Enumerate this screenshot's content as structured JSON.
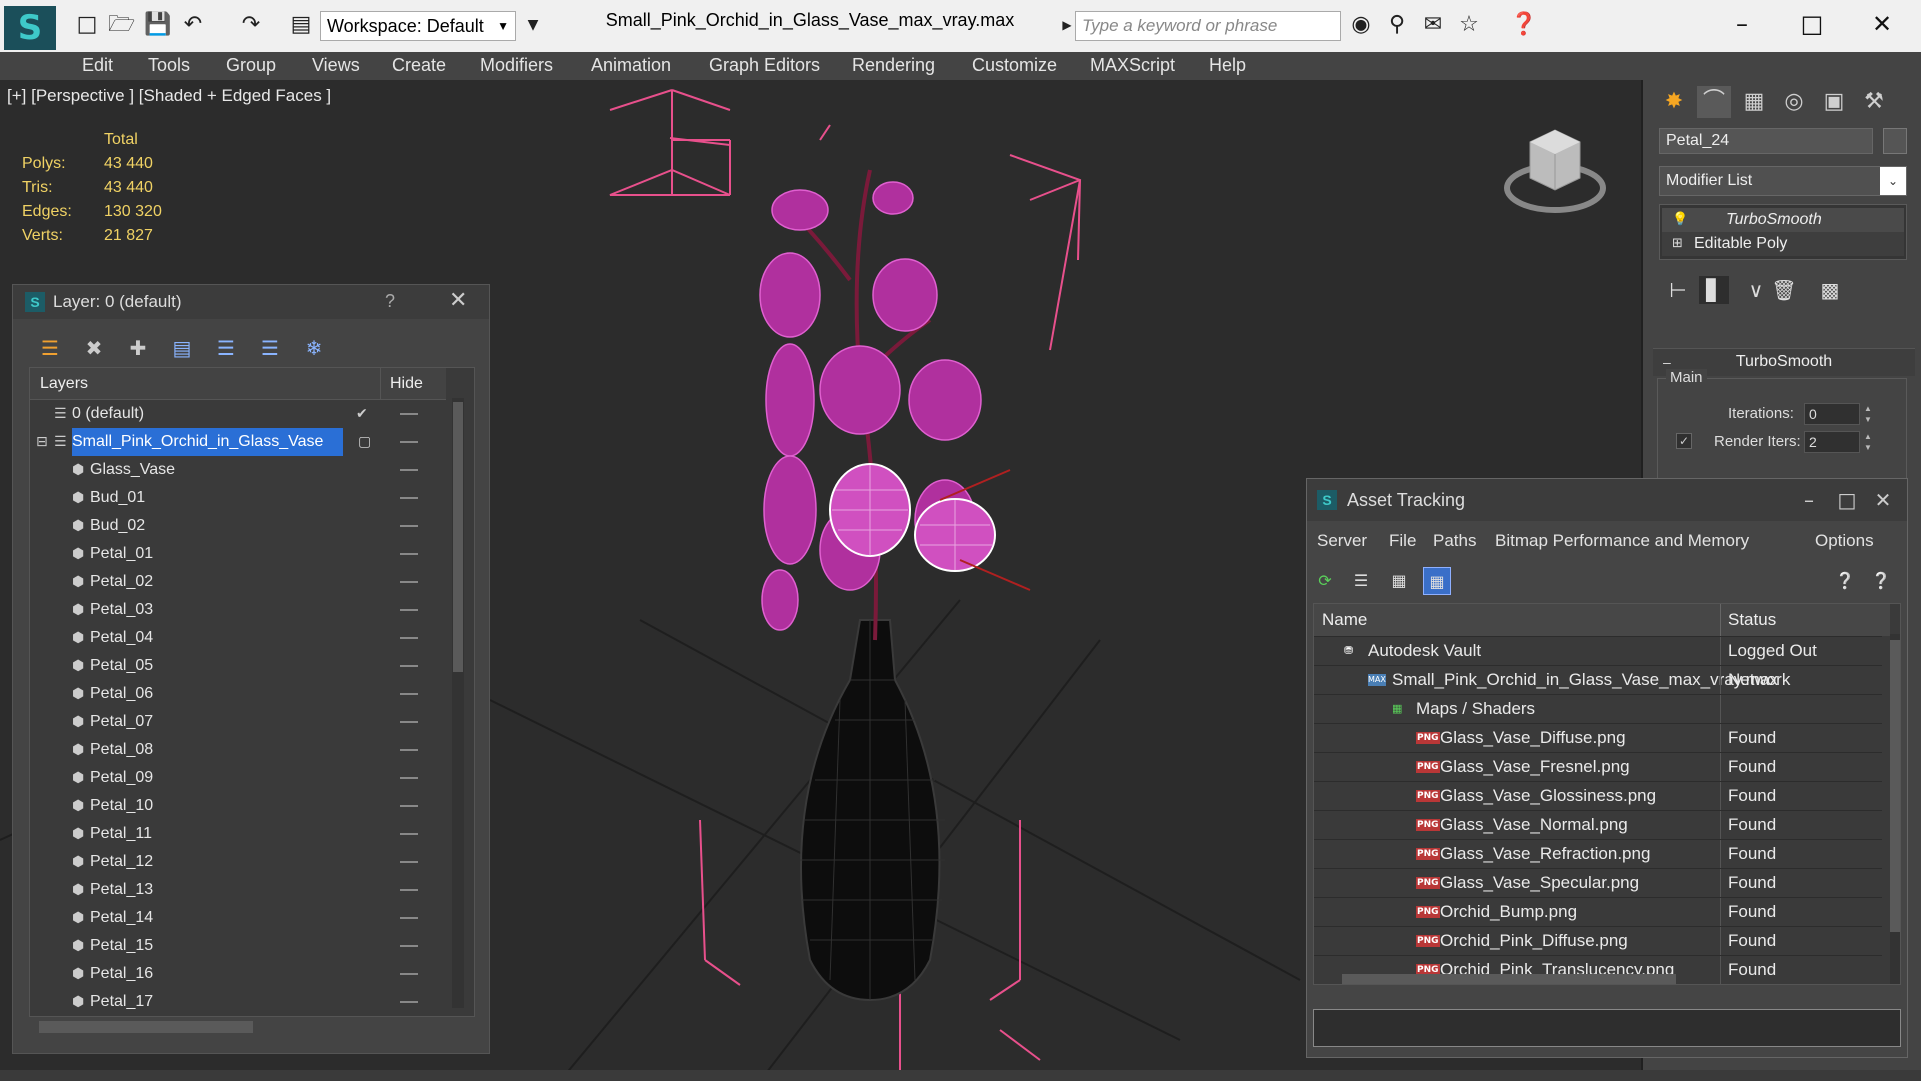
{
  "app": {
    "document_title": "Small_Pink_Orchid_in_Glass_Vase_max_vray.max",
    "workspace": "Workspace: Default",
    "search_placeholder": "Type a keyword or phrase"
  },
  "menu": [
    "Edit",
    "Tools",
    "Group",
    "Views",
    "Create",
    "Modifiers",
    "Animation",
    "Graph Editors",
    "Rendering",
    "Customize",
    "MAXScript",
    "Help"
  ],
  "viewport": {
    "label": "[+] [Perspective ] [Shaded + Edged Faces ]",
    "stats_header": "Total",
    "stats": [
      {
        "k": "Polys:",
        "v": "43 440"
      },
      {
        "k": "Tris:",
        "v": "43 440"
      },
      {
        "k": "Edges:",
        "v": "130 320"
      },
      {
        "k": "Verts:",
        "v": "21 827"
      }
    ]
  },
  "command_panel": {
    "object_name": "Petal_24",
    "modifier_list": "Modifier List",
    "stack": [
      "TurboSmooth",
      "Editable Poly"
    ],
    "rollout_title": "TurboSmooth",
    "group_main": "Main",
    "iterations_label": "Iterations:",
    "iterations_value": "0",
    "render_iters_label": "Render Iters:",
    "render_iters_value": "2",
    "render_iters_checked": true
  },
  "layer_window": {
    "title": "Layer: 0 (default)",
    "help": "?",
    "col_layers": "Layers",
    "col_hide": "Hide",
    "rows": [
      {
        "name": "0 (default)",
        "level": 0,
        "type": "layer",
        "current": true
      },
      {
        "name": "Small_Pink_Orchid_in_Glass_Vase",
        "level": 0,
        "type": "layer",
        "selected": true
      },
      {
        "name": "Glass_Vase",
        "level": 1,
        "type": "object"
      },
      {
        "name": "Bud_01",
        "level": 1,
        "type": "object"
      },
      {
        "name": "Bud_02",
        "level": 1,
        "type": "object"
      },
      {
        "name": "Petal_01",
        "level": 1,
        "type": "object"
      },
      {
        "name": "Petal_02",
        "level": 1,
        "type": "object"
      },
      {
        "name": "Petal_03",
        "level": 1,
        "type": "object"
      },
      {
        "name": "Petal_04",
        "level": 1,
        "type": "object"
      },
      {
        "name": "Petal_05",
        "level": 1,
        "type": "object"
      },
      {
        "name": "Petal_06",
        "level": 1,
        "type": "object"
      },
      {
        "name": "Petal_07",
        "level": 1,
        "type": "object"
      },
      {
        "name": "Petal_08",
        "level": 1,
        "type": "object"
      },
      {
        "name": "Petal_09",
        "level": 1,
        "type": "object"
      },
      {
        "name": "Petal_10",
        "level": 1,
        "type": "object"
      },
      {
        "name": "Petal_11",
        "level": 1,
        "type": "object"
      },
      {
        "name": "Petal_12",
        "level": 1,
        "type": "object"
      },
      {
        "name": "Petal_13",
        "level": 1,
        "type": "object"
      },
      {
        "name": "Petal_14",
        "level": 1,
        "type": "object"
      },
      {
        "name": "Petal_15",
        "level": 1,
        "type": "object"
      },
      {
        "name": "Petal_16",
        "level": 1,
        "type": "object"
      },
      {
        "name": "Petal_17",
        "level": 1,
        "type": "object"
      }
    ]
  },
  "asset_window": {
    "title": "Asset Tracking",
    "menu": [
      "Server",
      "File",
      "Paths",
      "Bitmap Performance and Memory",
      "Options"
    ],
    "col_name": "Name",
    "col_status": "Status",
    "rows": [
      {
        "name": "Autodesk Vault",
        "status": "Logged Out",
        "level": 0,
        "icon": "vault"
      },
      {
        "name": "Small_Pink_Orchid_in_Glass_Vase_max_vray.max",
        "status": "Network",
        "level": 1,
        "icon": "max"
      },
      {
        "name": "Maps / Shaders",
        "status": "",
        "level": 2,
        "icon": "maps"
      },
      {
        "name": "Glass_Vase_Diffuse.png",
        "status": "Found",
        "level": 3,
        "icon": "png"
      },
      {
        "name": "Glass_Vase_Fresnel.png",
        "status": "Found",
        "level": 3,
        "icon": "png"
      },
      {
        "name": "Glass_Vase_Glossiness.png",
        "status": "Found",
        "level": 3,
        "icon": "png"
      },
      {
        "name": "Glass_Vase_Normal.png",
        "status": "Found",
        "level": 3,
        "icon": "png"
      },
      {
        "name": "Glass_Vase_Refraction.png",
        "status": "Found",
        "level": 3,
        "icon": "png"
      },
      {
        "name": "Glass_Vase_Specular.png",
        "status": "Found",
        "level": 3,
        "icon": "png"
      },
      {
        "name": "Orchid_Bump.png",
        "status": "Found",
        "level": 3,
        "icon": "png"
      },
      {
        "name": "Orchid_Pink_Diffuse.png",
        "status": "Found",
        "level": 3,
        "icon": "png"
      },
      {
        "name": "Orchid_Pink_Translucency.png",
        "status": "Found",
        "level": 3,
        "icon": "png"
      }
    ]
  },
  "colors": {
    "stats_yellow": "#f0d264",
    "selection_blue": "#2a6fd6",
    "orchid_magenta": "#c83ab8",
    "bbox_pink": "#e8508c"
  }
}
